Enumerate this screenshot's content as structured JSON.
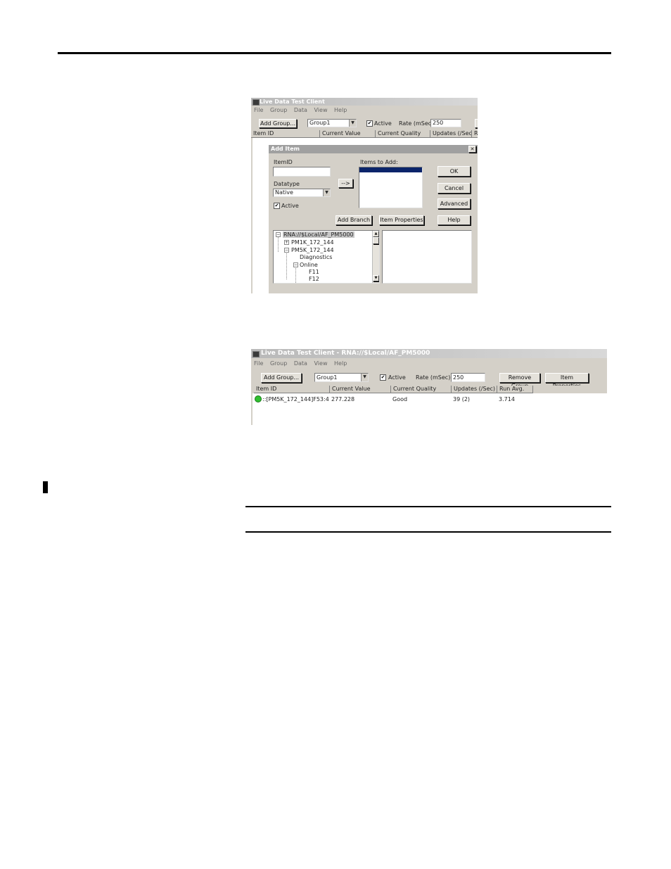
{
  "screenshot1": {
    "title": "Live Data Test Client",
    "menu": [
      "File",
      "Group",
      "Data",
      "View",
      "Help"
    ],
    "toolbar": {
      "add_group_label": "Add Group...",
      "group_value": "Group1",
      "active_label": "Active",
      "active_checked": "✔",
      "rate_label": "Rate (mSec)",
      "rate_value": "250"
    },
    "columns": [
      "Item ID",
      "Current Value",
      "Current Quality",
      "Updates (/Sec)",
      "R"
    ],
    "dialog": {
      "title": "Add Item",
      "close_glyph": "✕",
      "itemid_label": "ItemID",
      "items_to_add_label": "Items to Add:",
      "arrow_button_label": "-->",
      "datatype_label": "Datatype",
      "datatype_value": "Native",
      "active_label": "Active",
      "active_checked": "✔",
      "ok_label": "OK",
      "cancel_label": "Cancel",
      "advanced_label": "Advanced",
      "help_label": "Help",
      "add_branch_label": "Add Branch",
      "item_properties_label": "Item Properties",
      "tree": {
        "root": "RNA://$Local/AF_PM5000",
        "node1": "PM1K_172_144",
        "node2": "PM5K_172_144",
        "child_diagnostics": "Diagnostics",
        "child_online": "Online",
        "leaf_f11": "F11",
        "leaf_f12": "F12"
      }
    }
  },
  "screenshot2": {
    "title": "Live Data Test Client - RNA://$Local/AF_PM5000",
    "menu": [
      "File",
      "Group",
      "Data",
      "View",
      "Help"
    ],
    "toolbar": {
      "add_group_label": "Add Group...",
      "group_value": "Group1",
      "active_label": "Active",
      "active_checked": "✔",
      "rate_label": "Rate (mSec)",
      "rate_value": "250",
      "remove_group_label": "Remove Group",
      "item_properties_label": "Item Properties"
    },
    "columns": [
      "Item ID",
      "Current Value",
      "Current Quality",
      "Updates (/Sec)",
      "Run Avg."
    ],
    "row": {
      "item_id": "::[PM5K_172_144]F53:4",
      "current_value": "277.228",
      "current_quality": "Good",
      "updates": "39 (2)",
      "run_avg": "3.714"
    }
  },
  "colors": {
    "status_ok": "#2fbf2f",
    "selection": "#0a246a",
    "dialog_title": "#9a9a9a"
  }
}
